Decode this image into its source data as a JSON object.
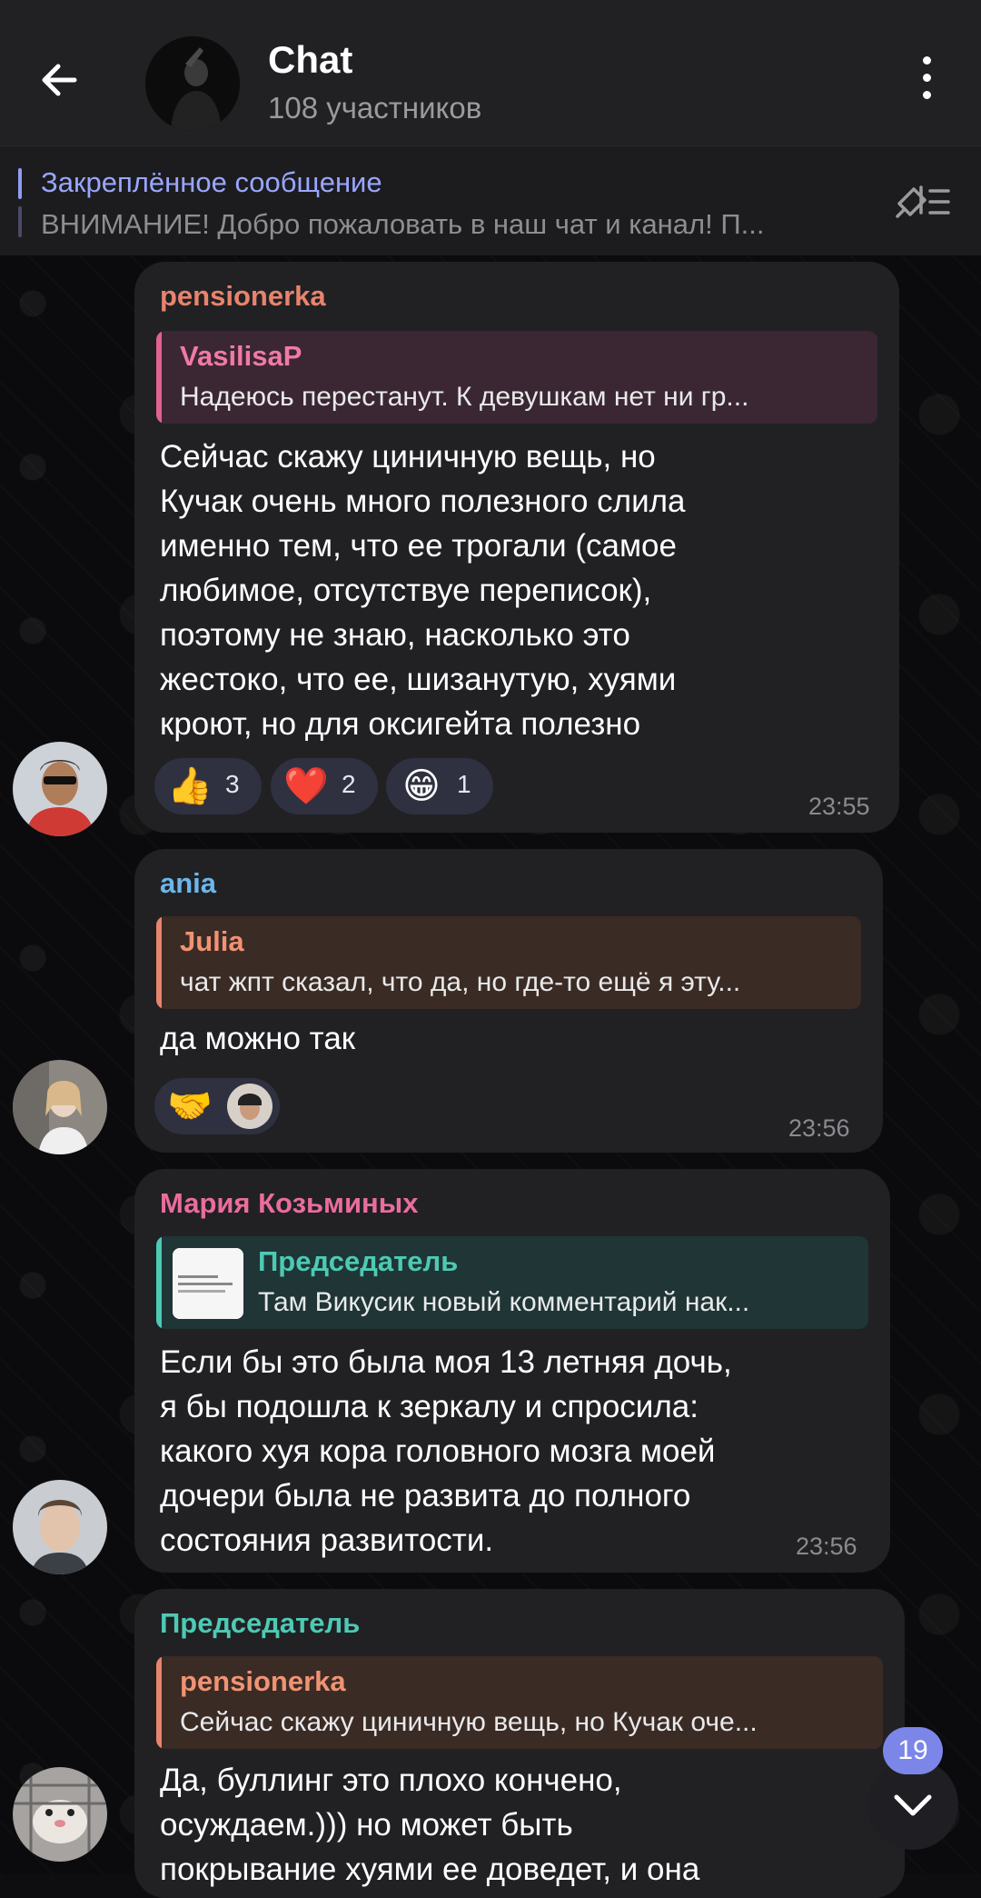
{
  "header": {
    "title": "Chat",
    "subtitle": "108 участников"
  },
  "pinned": {
    "title": "Закреплённое сообщение",
    "text": "ВНИМАНИЕ!  Добро пожаловать в наш чат и канал! П..."
  },
  "messages": [
    {
      "sender": "pensionerka",
      "sender_color": "#e7846c",
      "quote_name": "VasilisaP",
      "quote_text": "Надеюсь перестанут. К девушкам нет ни гр...",
      "quote_color": "#e0628f",
      "lines": [
        "Сейчас скажу циничную вещь, но",
        "Кучак очень много полезного слила",
        "именно тем, что ее трогали (самое",
        "любимое, отсутствуе переписок),",
        "поэтому не знаю, насколько это",
        "жестоко, что ее, шизанутую, хуями",
        "кроют, но для оксигейта полезно"
      ],
      "reactions": [
        {
          "emoji": "👍",
          "count": "3"
        },
        {
          "emoji": "❤️",
          "count": "2"
        },
        {
          "emoji": "😁",
          "count": "1"
        }
      ],
      "time": "23:55"
    },
    {
      "sender": "ania",
      "sender_color": "#6cb6ea",
      "quote_name": "Julia",
      "quote_text": "чат жпт сказал, что да, но где-то ещё я эту...",
      "quote_color": "#e7846c",
      "lines": [
        "да можно так"
      ],
      "reactions": [
        {
          "emoji": "🤝",
          "count": ""
        }
      ],
      "time": "23:56"
    },
    {
      "sender": "Мария Козьминых",
      "sender_color": "#ea6d9c",
      "quote_name": "Председатель",
      "quote_text": "Там Викусик новый комментарий нак...",
      "quote_color": "#4ec9b4",
      "lines": [
        "Если бы это была моя 13 летняя дочь,",
        "я бы подошла к зеркалу и спросила:",
        "какого хуя кора головного мозга моей",
        "дочери была не развита до полного",
        "состояния развитости."
      ],
      "time": "23:56"
    },
    {
      "sender": "Председатель",
      "sender_color": "#4ec9b4",
      "quote_name": "pensionerka",
      "quote_text": "Сейчас скажу циничную вещь, но Кучак оче...",
      "quote_color": "#e7846c",
      "lines": [
        "Да, буллинг это плохо кончено,",
        "осуждаем.))) но может быть",
        "покрывание хуями ее доведет, и она"
      ]
    }
  ],
  "scroll": {
    "unread_count": "19"
  }
}
